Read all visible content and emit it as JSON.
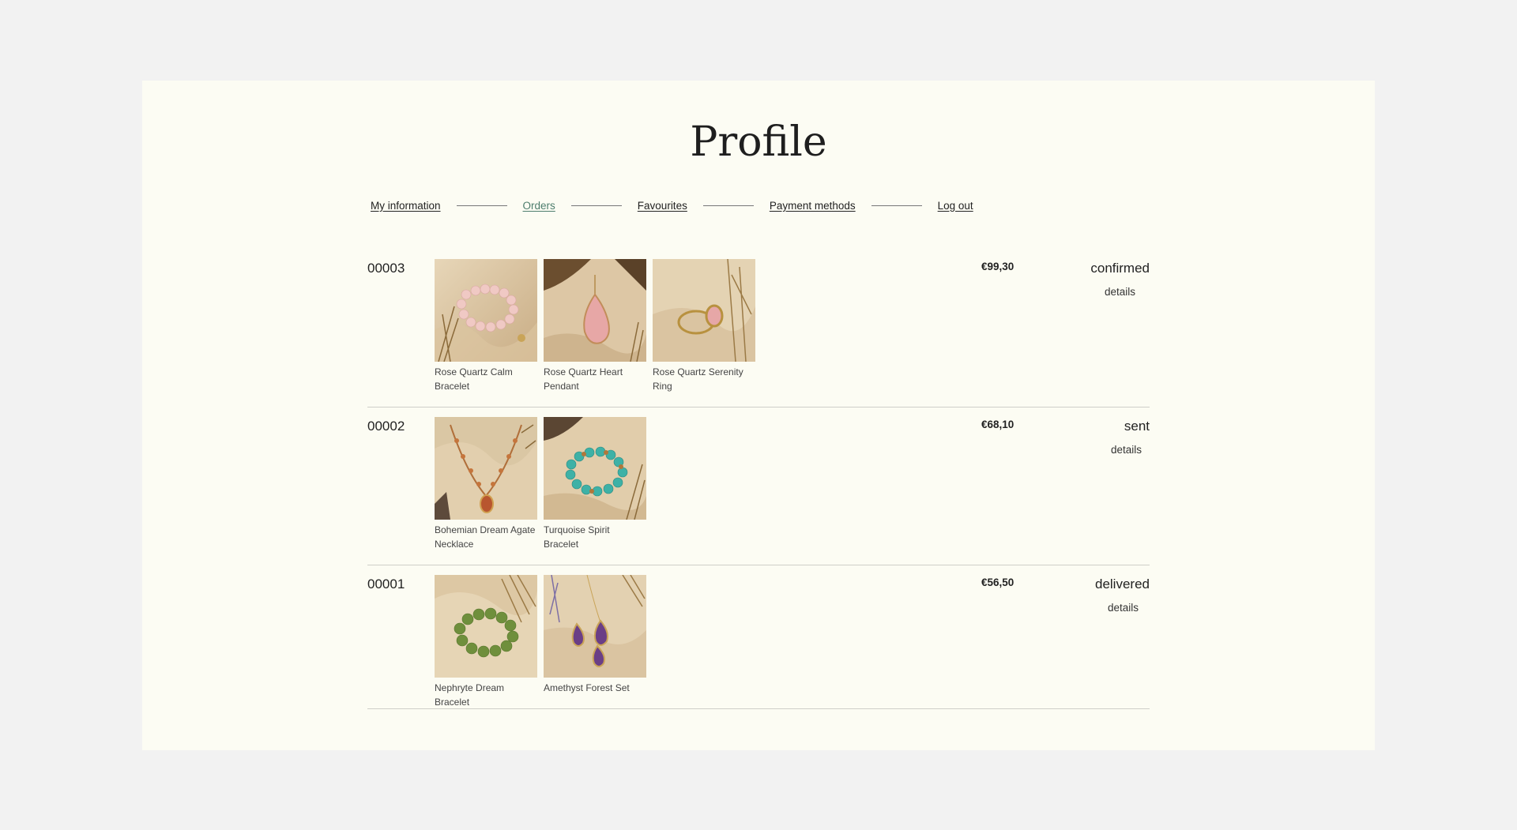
{
  "page": {
    "title": "Profile"
  },
  "nav": {
    "items": [
      {
        "label": "My information"
      },
      {
        "label": "Orders"
      },
      {
        "label": "Favourites"
      },
      {
        "label": "Payment methods"
      },
      {
        "label": "Log out"
      }
    ],
    "active_index": 1,
    "active_color": "#4d7d6c"
  },
  "orders": [
    {
      "id": "00003",
      "price": "€99,30",
      "status": "confirmed",
      "details_label": "details",
      "items": [
        {
          "name": "Rose Quartz Calm Bracelet",
          "icon": "bracelet-image"
        },
        {
          "name": "Rose Quartz Heart Pendant",
          "icon": "pendant-image"
        },
        {
          "name": "Rose Quartz Serenity Ring",
          "icon": "ring-image"
        }
      ]
    },
    {
      "id": "00002",
      "price": "€68,10",
      "status": "sent",
      "details_label": "details",
      "items": [
        {
          "name": "Bohemian Dream Agate Necklace",
          "icon": "necklace-image"
        },
        {
          "name": "Turquoise Spirit Bracelet",
          "icon": "bracelet-image"
        }
      ]
    },
    {
      "id": "00001",
      "price": "€56,50",
      "status": "delivered",
      "details_label": "details",
      "items": [
        {
          "name": "Nephryte Dream Bracelet",
          "icon": "bracelet-image"
        },
        {
          "name": "Amethyst Forest Set",
          "icon": "earrings-image"
        }
      ]
    }
  ]
}
